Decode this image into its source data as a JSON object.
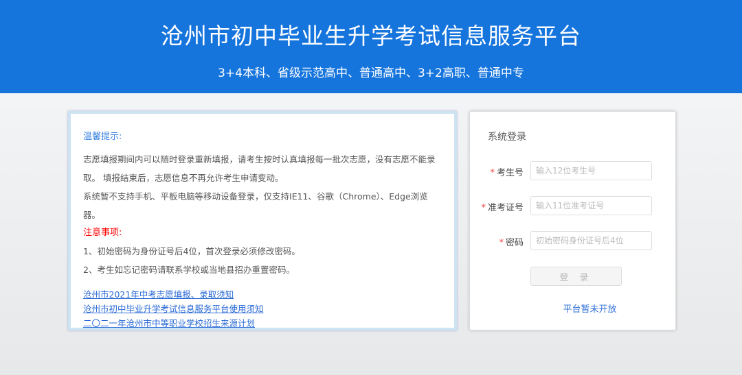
{
  "header": {
    "title": "沧州市初中毕业生升学考试信息服务平台",
    "subtitle": "3+4本科、省级示范高中、普通高中、3+2高职、普通中专"
  },
  "notice": {
    "tip_heading": "温馨提示:",
    "tips": [
      "志愿填报期间内可以随时登录重新填报，请考生按时认真填报每一批次志愿，没有志愿不能录取。 填报结束后，志愿信息不再允许考生申请变动。",
      "系统暂不支持手机、平板电脑等移动设备登录，仅支持IE11、谷歌（Chrome）、Edge浏览器。"
    ],
    "attention_heading": "注意事项:",
    "items": [
      "1、初始密码为身份证号后4位，首次登录必须修改密码。",
      "2、考生如忘记密码请联系学校或当地县招办重置密码。"
    ],
    "links": [
      "沧州市2021年中考志愿填报、录取须知",
      "沧州市初中毕业升学考试信息服务平台使用须知",
      "二〇二一年沧州市中等职业学校招生来源计划"
    ]
  },
  "login": {
    "title": "系统登录",
    "required_mark": "*",
    "fields": [
      {
        "label": "考生号",
        "placeholder": "输入12位考生号"
      },
      {
        "label": "准考证号",
        "placeholder": "输入11位准考证号"
      },
      {
        "label": "密码",
        "placeholder": "初始密码身份证号后4位"
      }
    ],
    "button": "登 录",
    "status": "平台暂未开放"
  }
}
